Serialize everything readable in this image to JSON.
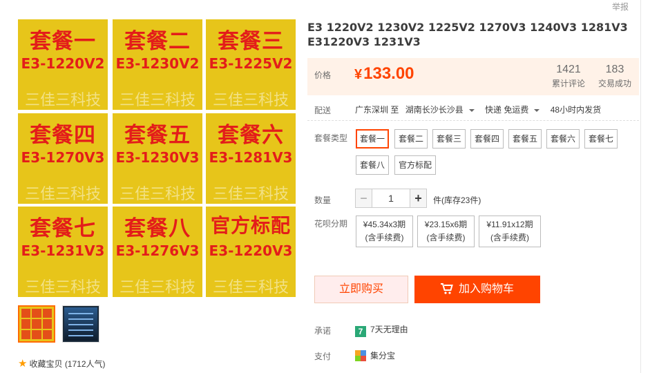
{
  "report_label": "举报",
  "gallery": {
    "tiles": [
      {
        "pkg": "套餐一",
        "model": "E3-1220V2",
        "brand": "三佳三科技"
      },
      {
        "pkg": "套餐二",
        "model": "E3-1230V2",
        "brand": "三佳三科技"
      },
      {
        "pkg": "套餐三",
        "model": "E3-1225V2",
        "brand": "三佳三科技"
      },
      {
        "pkg": "套餐四",
        "model": "E3-1270V3",
        "brand": "三佳三科技"
      },
      {
        "pkg": "套餐五",
        "model": "E3-1230V3",
        "brand": "三佳三科技"
      },
      {
        "pkg": "套餐六",
        "model": "E3-1281V3",
        "brand": "三佳三科技"
      },
      {
        "pkg": "套餐七",
        "model": "E3-1231V3",
        "brand": "三佳三科技"
      },
      {
        "pkg": "套餐八",
        "model": "E3-1276V3",
        "brand": "三佳三科技"
      },
      {
        "pkg": "官方标配",
        "model": "E3-1220V3",
        "brand": "三佳三科技"
      }
    ]
  },
  "favorite": {
    "label": "收藏宝贝",
    "count": "(1712人气)"
  },
  "product": {
    "title_line1": "E3 1220V2 1230V2 1225V2 1270V3 1240V3 1281V3",
    "title_line2": "E31220V3 1231V3"
  },
  "price": {
    "label": "价格",
    "currency": "¥",
    "value": "133.00",
    "reviews_count": "1421",
    "reviews_label": "累计评论",
    "deals_count": "183",
    "deals_label": "交易成功"
  },
  "shipping": {
    "label": "配送",
    "from": "广东深圳 至",
    "to": "湖南长沙长沙县",
    "method": "快递 免运费",
    "dispatch": "48小时内发货"
  },
  "sku": {
    "label": "套餐类型",
    "options": [
      "套餐一",
      "套餐二",
      "套餐三",
      "套餐四",
      "套餐五",
      "套餐六",
      "套餐七",
      "套餐八",
      "官方标配"
    ],
    "selected": "套餐一"
  },
  "quantity": {
    "label": "数量",
    "value": "1",
    "minus": "−",
    "plus": "+",
    "stock": "件(库存23件)"
  },
  "installment": {
    "label": "花呗分期",
    "options": [
      {
        "amount": "¥45.34x3期",
        "note": "(含手续费)"
      },
      {
        "amount": "¥23.15x6期",
        "note": "(含手续费)"
      },
      {
        "amount": "¥11.91x12期",
        "note": "(含手续费)"
      }
    ]
  },
  "actions": {
    "buy_now": "立即购买",
    "add_to_cart": "加入购物车"
  },
  "promise": {
    "label": "承诺",
    "badge": "7",
    "text": "7天无理由"
  },
  "payment": {
    "label": "支付",
    "text": "集分宝"
  },
  "colors": {
    "accent": "#ff4400",
    "tile_bg": "#e7c51a",
    "tile_text": "#e31d1a"
  }
}
